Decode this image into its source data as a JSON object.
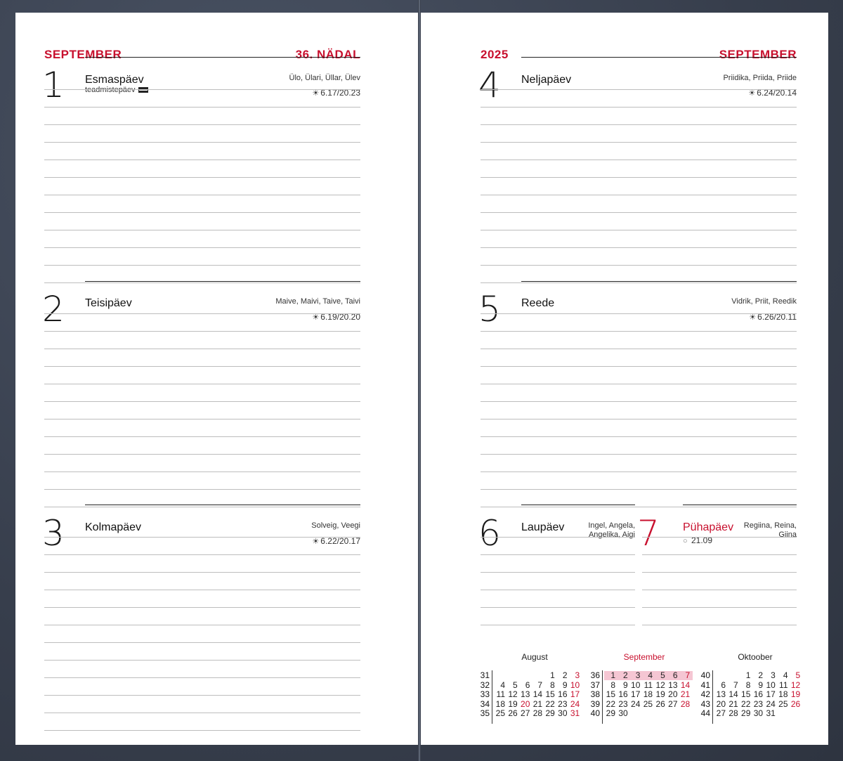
{
  "left_page": {
    "month": "SEPTEMBER",
    "week": "36. NÄDAL",
    "days": [
      {
        "num": "1",
        "name": "Esmaspäev",
        "sub": "teadmistepäev",
        "names": "Ülo, Ülari, Üllar, Ülev",
        "sun": "6.17/20.23"
      },
      {
        "num": "2",
        "name": "Teisipäev",
        "sub": "",
        "names": "Maive, Maivi, Taive, Taivi",
        "sun": "6.19/20.20"
      },
      {
        "num": "3",
        "name": "Kolmapäev",
        "sub": "",
        "names": "Solveig, Veegi",
        "sun": "6.22/20.17"
      }
    ]
  },
  "right_page": {
    "year": "2025",
    "month": "SEPTEMBER",
    "days": [
      {
        "num": "4",
        "name": "Neljapäev",
        "names": "Priidika, Priida, Priide",
        "sun": "6.24/20.14"
      },
      {
        "num": "5",
        "name": "Reede",
        "names": "Vidrik, Priit, Reedik",
        "sun": "6.26/20.11"
      },
      {
        "num": "6",
        "name": "Laupäev",
        "names_line1": "Ingel, Angela,",
        "names_line2": "Angelika, Aigi"
      },
      {
        "num": "7",
        "name": "Pühapäev",
        "names_line1": "Regiina, Reina,",
        "names_line2": "Giina",
        "moon": "21.09"
      }
    ]
  },
  "mini_calendars": [
    {
      "title": "August",
      "highlight": false,
      "rows": [
        {
          "wk": "31",
          "days": [
            "",
            "",
            "",
            "",
            "1",
            "2",
            "3"
          ]
        },
        {
          "wk": "32",
          "days": [
            "4",
            "5",
            "6",
            "7",
            "8",
            "9",
            "10"
          ]
        },
        {
          "wk": "33",
          "days": [
            "11",
            "12",
            "13",
            "14",
            "15",
            "16",
            "17"
          ]
        },
        {
          "wk": "34",
          "days": [
            "18",
            "19",
            "20",
            "21",
            "22",
            "23",
            "24"
          ]
        },
        {
          "wk": "35",
          "days": [
            "25",
            "26",
            "27",
            "28",
            "29",
            "30",
            "31"
          ]
        }
      ],
      "red_extra": [
        "20"
      ]
    },
    {
      "title": "September",
      "highlight": true,
      "rows": [
        {
          "wk": "36",
          "days": [
            "1",
            "2",
            "3",
            "4",
            "5",
            "6",
            "7"
          ]
        },
        {
          "wk": "37",
          "days": [
            "8",
            "9",
            "10",
            "11",
            "12",
            "13",
            "14"
          ]
        },
        {
          "wk": "38",
          "days": [
            "15",
            "16",
            "17",
            "18",
            "19",
            "20",
            "21"
          ]
        },
        {
          "wk": "39",
          "days": [
            "22",
            "23",
            "24",
            "25",
            "26",
            "27",
            "28"
          ]
        },
        {
          "wk": "40",
          "days": [
            "29",
            "30",
            "",
            "",
            "",
            "",
            ""
          ]
        }
      ],
      "red_extra": []
    },
    {
      "title": "Oktoober",
      "highlight": false,
      "rows": [
        {
          "wk": "40",
          "days": [
            "",
            "",
            "1",
            "2",
            "3",
            "4",
            "5"
          ]
        },
        {
          "wk": "41",
          "days": [
            "6",
            "7",
            "8",
            "9",
            "10",
            "11",
            "12"
          ]
        },
        {
          "wk": "42",
          "days": [
            "13",
            "14",
            "15",
            "16",
            "17",
            "18",
            "19"
          ]
        },
        {
          "wk": "43",
          "days": [
            "20",
            "21",
            "22",
            "23",
            "24",
            "25",
            "26"
          ]
        },
        {
          "wk": "44",
          "days": [
            "27",
            "28",
            "29",
            "30",
            "31",
            "",
            ""
          ]
        }
      ],
      "red_extra": []
    }
  ],
  "colors": {
    "accent": "#c8102e",
    "cover": "#3e4656",
    "highlight": "#f5c6d3"
  }
}
